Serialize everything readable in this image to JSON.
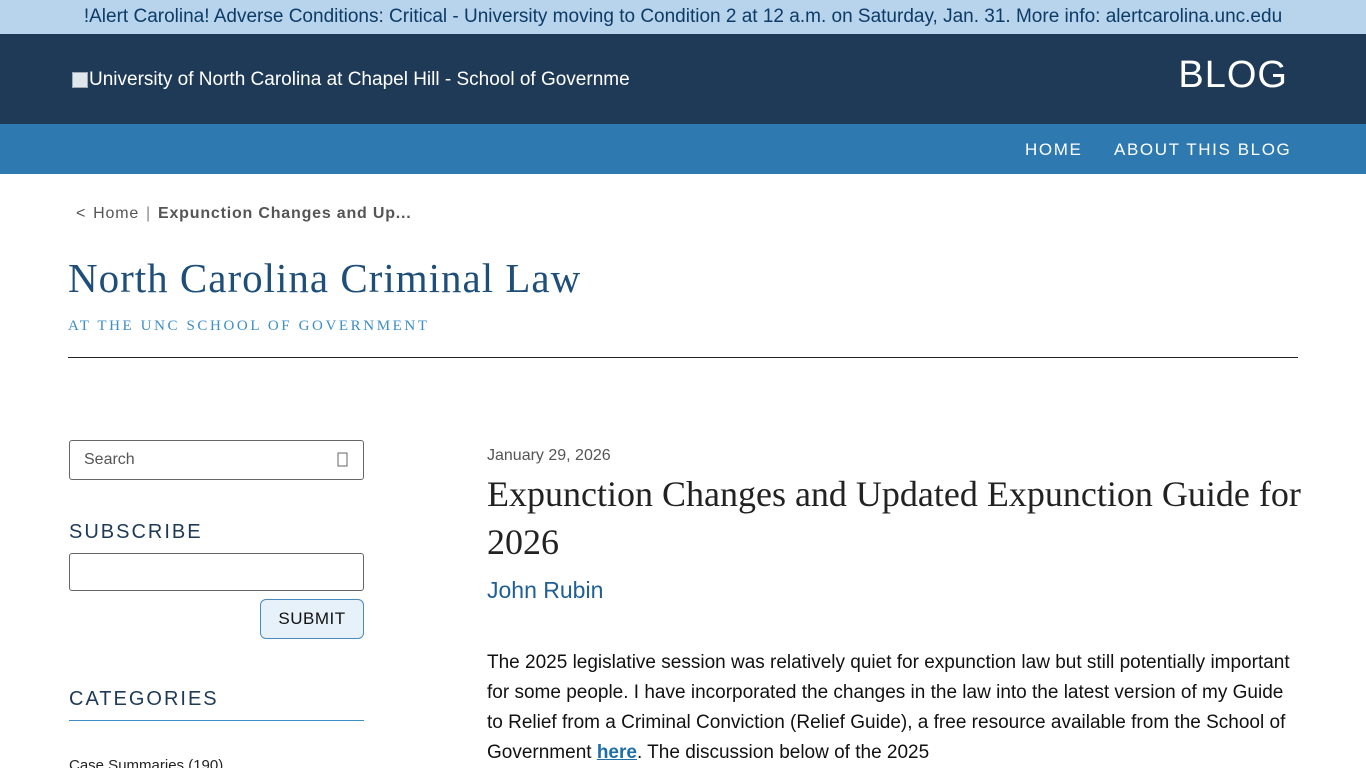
{
  "alert": {
    "text": "!Alert Carolina! Adverse Conditions: Critical - University moving to Condition 2 at 12 a.m. on Saturday, Jan. 31. More info: alertcarolina.unc.edu"
  },
  "header": {
    "logo_alt": "University of North Carolina at Chapel Hill - School of Governme",
    "blog_label": "BLOG"
  },
  "nav": {
    "items": [
      {
        "label": "HOME"
      },
      {
        "label": "ABOUT THIS BLOG"
      }
    ]
  },
  "breadcrumb": {
    "back": "<",
    "home": "Home",
    "separator": "|",
    "current": "Expunction Changes and Up..."
  },
  "site": {
    "title": "North Carolina Criminal Law",
    "subtitle": "AT THE UNC SCHOOL OF GOVERNMENT"
  },
  "sidebar": {
    "search_placeholder": "Search",
    "subscribe_heading": "SUBSCRIBE",
    "subscribe_value": "",
    "submit_label": "SUBMIT",
    "categories_heading": "CATEGORIES",
    "categories": [
      {
        "label": "Case Summaries (190)"
      }
    ]
  },
  "post": {
    "date": "January 29, 2026",
    "title": "Expunction Changes and Updated Expunction Guide for 2026",
    "author": "John Rubin",
    "body_before_link": "The 2025 legislative session was relatively quiet for expunction law but still potentially important for some people. I have incorporated the changes in the law into the latest version of my Guide to Relief from a Criminal Conviction (Relief Guide), a free resource available from the School of Government ",
    "link_text": "here",
    "body_after_link": ". The discussion below of the 2025"
  },
  "colors": {
    "alert_bg": "#b7d4ec",
    "header_bg": "#1e3a56",
    "nav_bg": "#2e7ab0",
    "title_blue": "#1e4e7a",
    "subtitle_blue": "#3b8ec6"
  }
}
